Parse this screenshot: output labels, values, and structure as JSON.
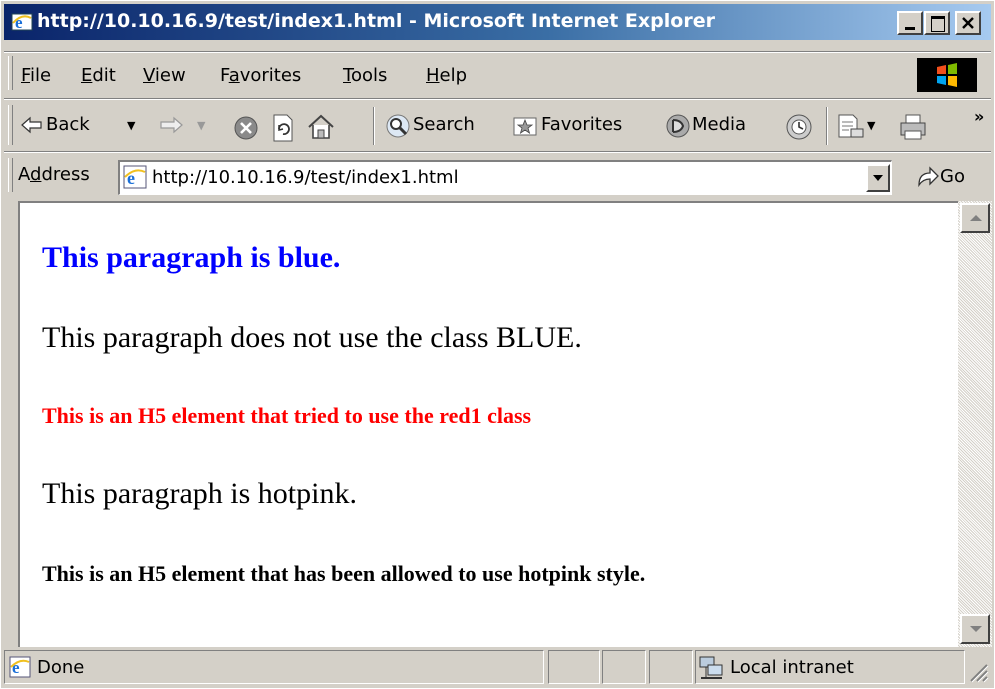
{
  "window": {
    "title": "http://10.10.16.9/test/index1.html - Microsoft Internet Explorer",
    "controls": {
      "minimize": "_",
      "maximize": "□",
      "close": "×"
    }
  },
  "menu": {
    "items": [
      {
        "label": "File",
        "underline": "F",
        "rest": "ile"
      },
      {
        "label": "Edit",
        "underline": "E",
        "rest": "dit"
      },
      {
        "label": "View",
        "underline": "V",
        "rest": "iew"
      },
      {
        "label": "Favorites",
        "pre": "F",
        "underline": "a",
        "rest": "vorites"
      },
      {
        "label": "Tools",
        "underline": "T",
        "rest": "ools"
      },
      {
        "label": "Help",
        "underline": "H",
        "rest": "elp"
      }
    ]
  },
  "toolbar": {
    "back": "Back",
    "search": "Search",
    "favorites": "Favorites",
    "media": "Media",
    "more": "»"
  },
  "address": {
    "label_pre": "A",
    "label_ul": "d",
    "label_rest": "dress",
    "url": "http://10.10.16.9/test/index1.html",
    "go": "Go"
  },
  "page": {
    "p_blue": "This paragraph is blue.",
    "p_plain": "This paragraph does not use the class BLUE.",
    "h5_red": "This is an H5 element that tried to use the red1 class",
    "p_hotpink": "This paragraph is hotpink.",
    "h5_hotpink": "This is an H5 element that has been allowed to use hotpink style.",
    "colors": {
      "blue": "#0000ff",
      "red": "#ff0000",
      "black": "#000000"
    }
  },
  "status": {
    "text": "Done",
    "zone": "Local intranet"
  },
  "icons": [
    "ie-logo-icon",
    "back-arrow-icon",
    "forward-arrow-icon",
    "stop-icon",
    "refresh-icon",
    "home-icon",
    "search-icon",
    "favorites-icon",
    "media-icon",
    "history-icon",
    "mail-icon",
    "print-icon",
    "go-arrow-icon",
    "windows-logo-icon",
    "local-intranet-icon",
    "scroll-up-icon",
    "scroll-down-icon",
    "resize-grip-icon"
  ]
}
